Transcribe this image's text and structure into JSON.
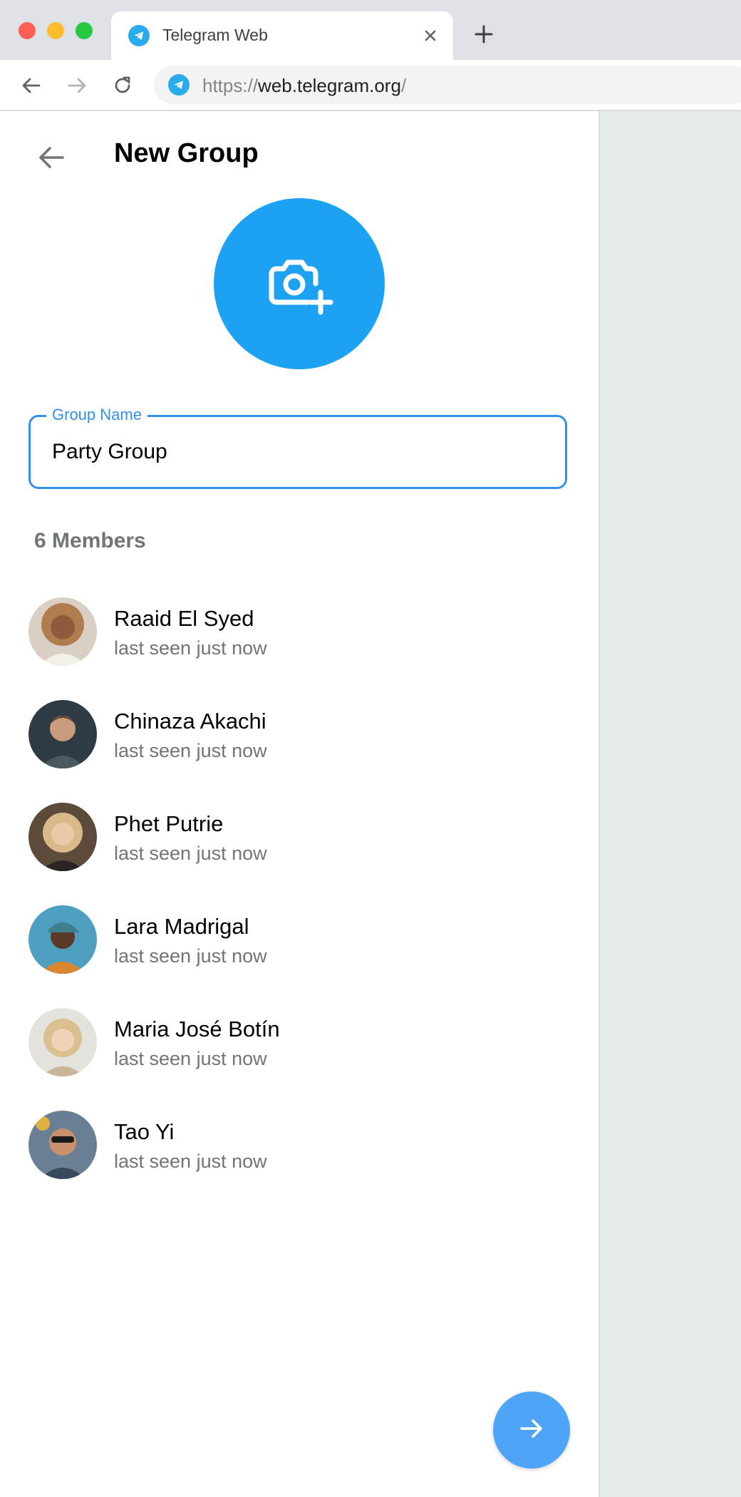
{
  "browser": {
    "tab_title": "Telegram Web",
    "url_scheme": "https://",
    "url_host": "web.telegram.org",
    "url_path": "/"
  },
  "header": {
    "title": "New Group"
  },
  "group_name_field": {
    "label": "Group Name",
    "value": "Party Group"
  },
  "members_header": "6 Members",
  "members": [
    {
      "name": "Raaid El Syed",
      "status": "last seen just now"
    },
    {
      "name": "Chinaza Akachi",
      "status": "last seen just now"
    },
    {
      "name": "Phet Putrie",
      "status": "last seen just now"
    },
    {
      "name": "Lara Madrigal",
      "status": "last seen just now"
    },
    {
      "name": "Maria José Botín",
      "status": "last seen just now"
    },
    {
      "name": "Tao Yi",
      "status": "last seen just now"
    }
  ],
  "colors": {
    "accent": "#3390ec",
    "avatar_upload_bg": "#1da1f2",
    "fab_bg": "#4ea4f6",
    "secondary_text": "#707579",
    "right_panel_bg": "#e6ebee"
  },
  "icons": {
    "back": "arrow-left-icon",
    "avatar_upload": "camera-add-icon",
    "fab": "arrow-right-icon"
  }
}
